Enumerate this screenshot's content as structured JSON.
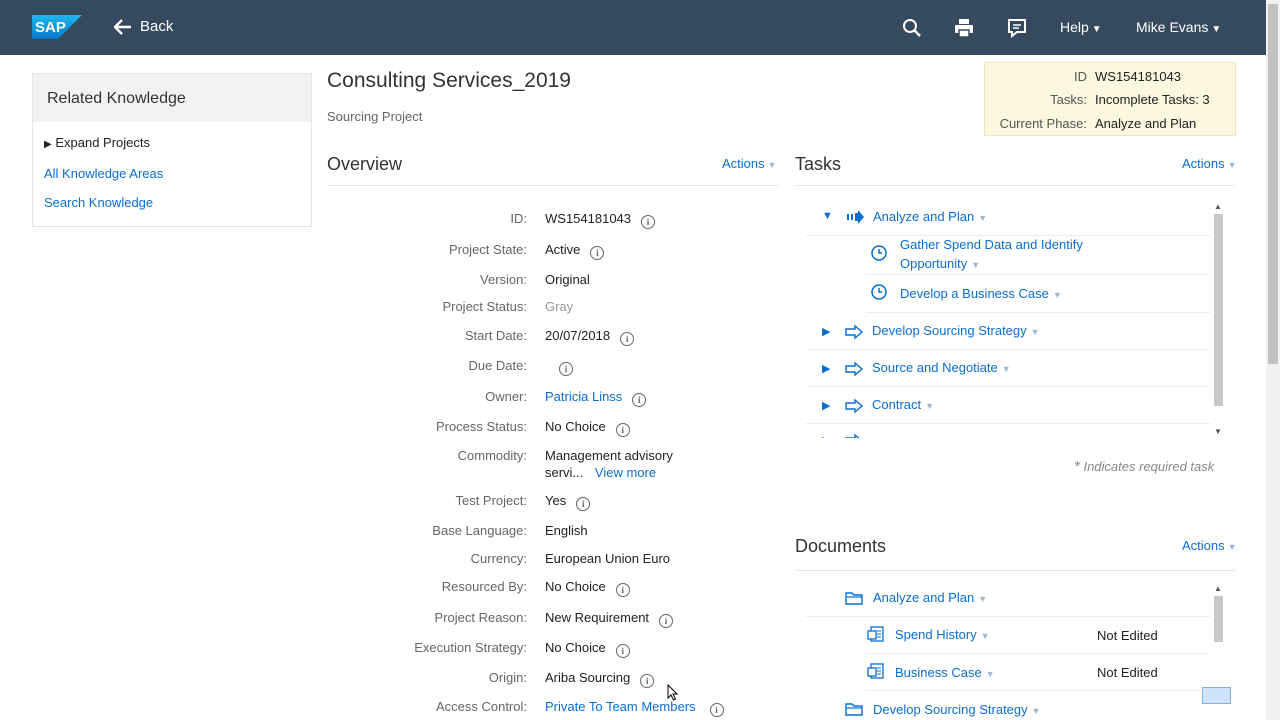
{
  "header": {
    "logo_text": "SAP",
    "back_label": "Back",
    "help_label": "Help",
    "user_label": "Mike Evans"
  },
  "related_knowledge": {
    "title": "Related Knowledge",
    "expand_label": "Expand Projects",
    "links": [
      "All Knowledge Areas",
      "Search Knowledge"
    ]
  },
  "page": {
    "title": "Consulting Services_2019",
    "subtitle": "Sourcing Project"
  },
  "infobox": {
    "id_label": "ID",
    "id_value": "WS154181043",
    "tasks_label": "Tasks:",
    "tasks_value": "Incomplete Tasks: 3",
    "phase_label": "Current Phase:",
    "phase_value": "Analyze and Plan"
  },
  "overview": {
    "title": "Overview",
    "actions_label": "Actions",
    "fields": [
      {
        "label": "ID:",
        "value": "WS154181043"
      },
      {
        "label": "Project State:",
        "value": "Active"
      },
      {
        "label": "Version:",
        "value": "Original"
      },
      {
        "label": "Project Status:",
        "value": "Gray"
      },
      {
        "label": "Start Date:",
        "value": "20/07/2018"
      },
      {
        "label": "Due Date:",
        "value": ""
      },
      {
        "label": "Owner:",
        "value": "Patricia Linss"
      },
      {
        "label": "Process Status:",
        "value": "No Choice"
      },
      {
        "label": "Commodity:",
        "value": "Management advisory",
        "value2": "servi...",
        "more": "View more"
      },
      {
        "label": "Test Project:",
        "value": "Yes"
      },
      {
        "label": "Base Language:",
        "value": "English"
      },
      {
        "label": "Currency:",
        "value": "European Union Euro"
      },
      {
        "label": "Resourced By:",
        "value": "No Choice"
      },
      {
        "label": "Project Reason:",
        "value": "New Requirement"
      },
      {
        "label": "Execution Strategy:",
        "value": "No Choice"
      },
      {
        "label": "Origin:",
        "value": "Ariba Sourcing"
      },
      {
        "label": "Access Control:",
        "value": "Private To Team Members"
      }
    ]
  },
  "tasks": {
    "title": "Tasks",
    "actions_label": "Actions",
    "items": [
      {
        "label": "Analyze and Plan"
      },
      {
        "label": "Gather Spend Data and Identify",
        "label2": "Opportunity"
      },
      {
        "label": "Develop a Business Case"
      },
      {
        "label": "Develop Sourcing Strategy"
      },
      {
        "label": "Source and Negotiate"
      },
      {
        "label": "Contract"
      }
    ],
    "required_note": "Indicates required task",
    "required_mark": "*"
  },
  "documents": {
    "title": "Documents",
    "actions_label": "Actions",
    "items": [
      {
        "label": "Analyze and Plan",
        "status": ""
      },
      {
        "label": "Spend History",
        "status": "Not Edited"
      },
      {
        "label": "Business Case",
        "status": "Not Edited"
      },
      {
        "label": "Develop Sourcing Strategy",
        "status": ""
      }
    ]
  },
  "colors": {
    "header_bg": "#354a5f",
    "link": "#0a6ed1",
    "infobox_bg": "#fcf7df"
  }
}
